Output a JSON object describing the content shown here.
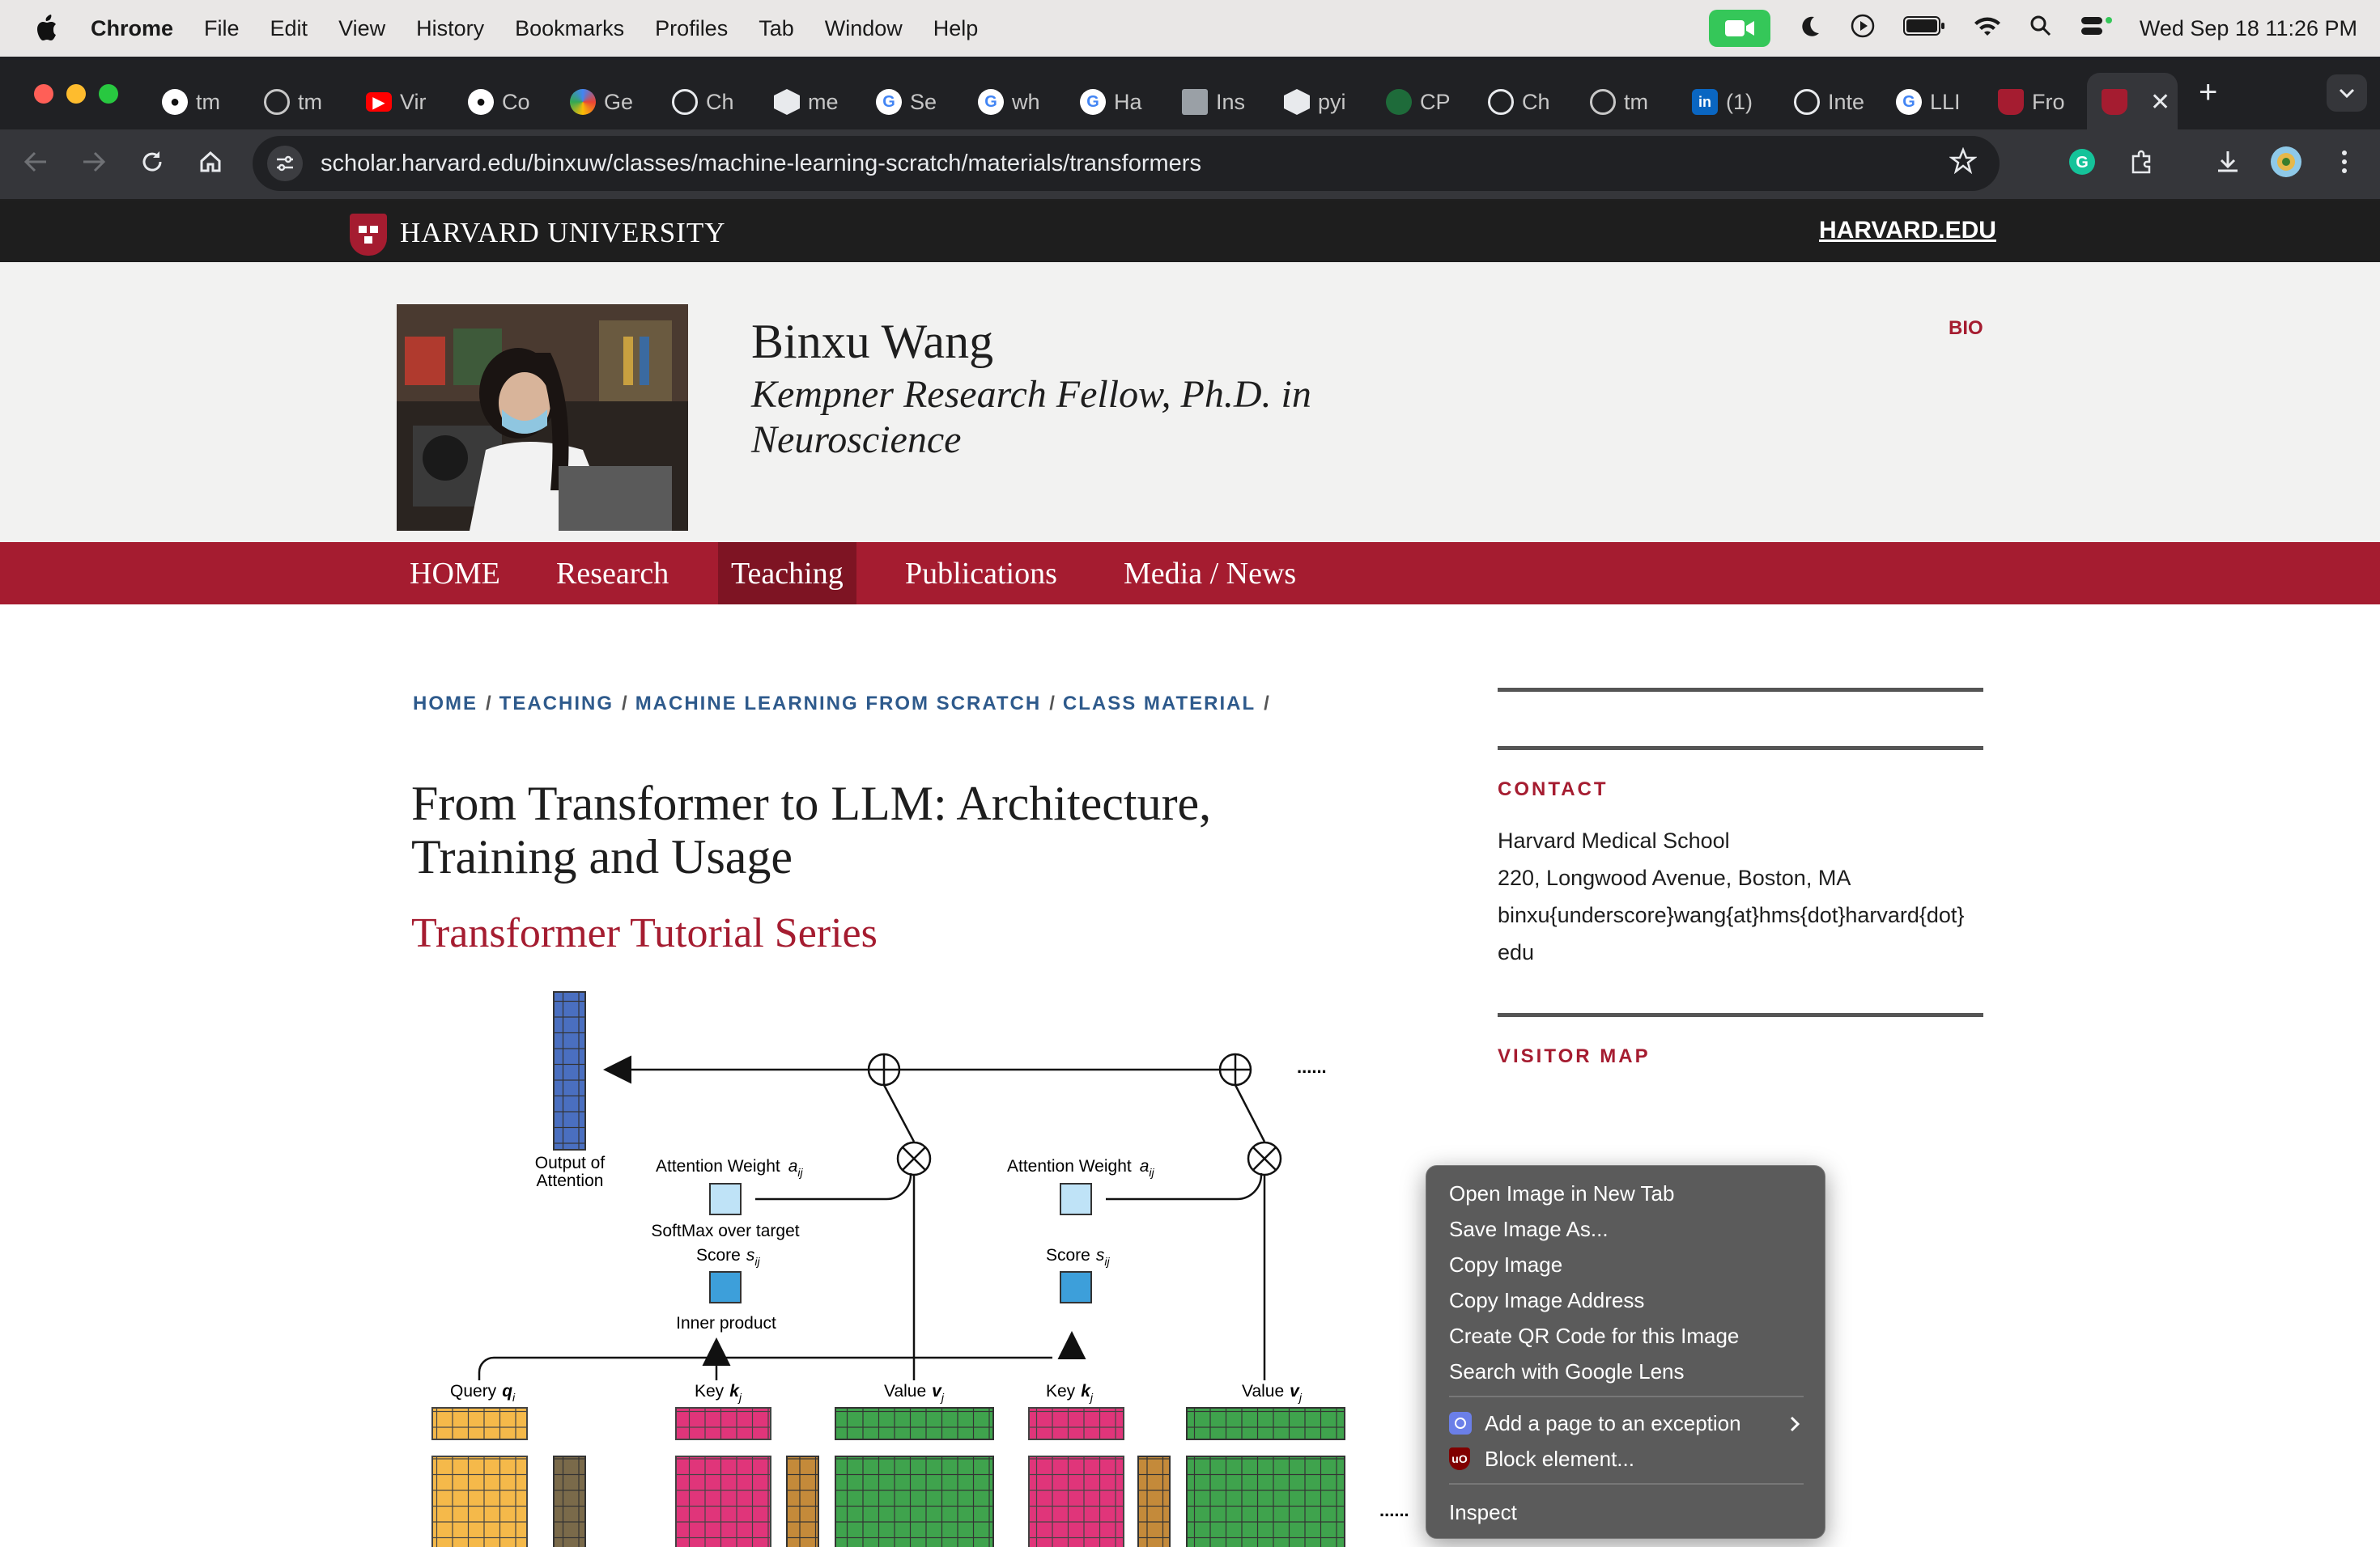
{
  "menubar": {
    "app_name": "Chrome",
    "items": [
      "File",
      "Edit",
      "View",
      "History",
      "Bookmarks",
      "Profiles",
      "Tab",
      "Window",
      "Help"
    ],
    "clock": "Wed Sep 18  11:26 PM"
  },
  "tabs": [
    {
      "label": "tm",
      "icon": "github-icon"
    },
    {
      "label": "tm",
      "icon": "globe-icon"
    },
    {
      "label": "Vir",
      "icon": "youtube-icon"
    },
    {
      "label": "Co",
      "icon": "github-icon"
    },
    {
      "label": "Ge",
      "icon": "gemini-icon"
    },
    {
      "label": "Ch",
      "icon": "chatgpt-icon"
    },
    {
      "label": "me",
      "icon": "cube-icon"
    },
    {
      "label": "Se",
      "icon": "google-icon"
    },
    {
      "label": "wh",
      "icon": "google-icon"
    },
    {
      "label": "Ha",
      "icon": "google-icon"
    },
    {
      "label": "Ins",
      "icon": "doc-icon"
    },
    {
      "label": "pyi",
      "icon": "cube-icon"
    },
    {
      "label": "CP",
      "icon": "green-shield-icon"
    },
    {
      "label": "Ch",
      "icon": "chatgpt-icon"
    },
    {
      "label": "tm",
      "icon": "globe-icon"
    },
    {
      "label": "(1)",
      "icon": "linkedin-icon"
    },
    {
      "label": "Inte",
      "icon": "chatgpt-icon"
    },
    {
      "label": "LLI",
      "icon": "google-icon"
    },
    {
      "label": "Fro",
      "icon": "harvard-shield-icon"
    }
  ],
  "toolbar": {
    "url": "scholar.harvard.edu/binxuw/classes/machine-learning-scratch/materials/transformers"
  },
  "harvard_bar": {
    "logo_text": "HARVARD UNIVERSITY",
    "link": "HARVARD.EDU"
  },
  "header": {
    "name": "Binxu Wang",
    "title_line1": "Kempner Research Fellow, Ph.D. in",
    "title_line2": "Neuroscience",
    "bio_link": "BIO"
  },
  "nav": {
    "items": [
      "HOME",
      "Research",
      "Teaching",
      "Publications",
      "Media / News"
    ],
    "active": "Teaching"
  },
  "breadcrumb": {
    "items": [
      "HOME",
      "TEACHING",
      "MACHINE LEARNING FROM SCRATCH",
      "CLASS MATERIAL"
    ],
    "separator": "/"
  },
  "article": {
    "title_line1": "From Transformer to LLM: Architecture,",
    "title_line2": "Training and Usage",
    "subtitle": "Transformer Tutorial Series"
  },
  "diagram": {
    "output_label_1": "Output of",
    "output_label_2": "Attention",
    "attention_weight_label": "Attention Weight",
    "attention_weight_symbol": "a",
    "softmax_label": "SoftMax over target",
    "score_label": "Score",
    "score_symbol": "s",
    "ij_sub": "ij",
    "inner_product_label": "Inner product",
    "query_label": "Query",
    "query_symbol": "q",
    "key_label": "Key",
    "key_symbol": "k",
    "value_label": "Value",
    "value_symbol": "v",
    "i_sub": "i",
    "j_sub": "j",
    "ellipsis": "......"
  },
  "sidebar": {
    "contact_heading": "CONTACT",
    "contact_lines": [
      "Harvard Medical School",
      "220, Longwood Avenue, Boston, MA",
      "binxu{underscore}wang{at}hms{dot}harvard{dot}",
      "edu"
    ],
    "visitor_map_heading": "VISITOR MAP"
  },
  "context_menu": {
    "items": [
      "Open Image in New Tab",
      "Save Image As...",
      "Copy Image",
      "Copy Image Address",
      "Create QR Code for this Image",
      "Search with Google Lens"
    ],
    "ext_items": [
      "Add a page to an exception",
      "Block element..."
    ],
    "inspect": "Inspect"
  },
  "colors": {
    "harvard_crimson": "#a51c30",
    "link_blue": "#2e5a8c",
    "query_orange": "#f5b94a",
    "key_pink": "#e0357a",
    "value_green": "#3fa34d",
    "attention_blue": "#4a6fc0"
  }
}
